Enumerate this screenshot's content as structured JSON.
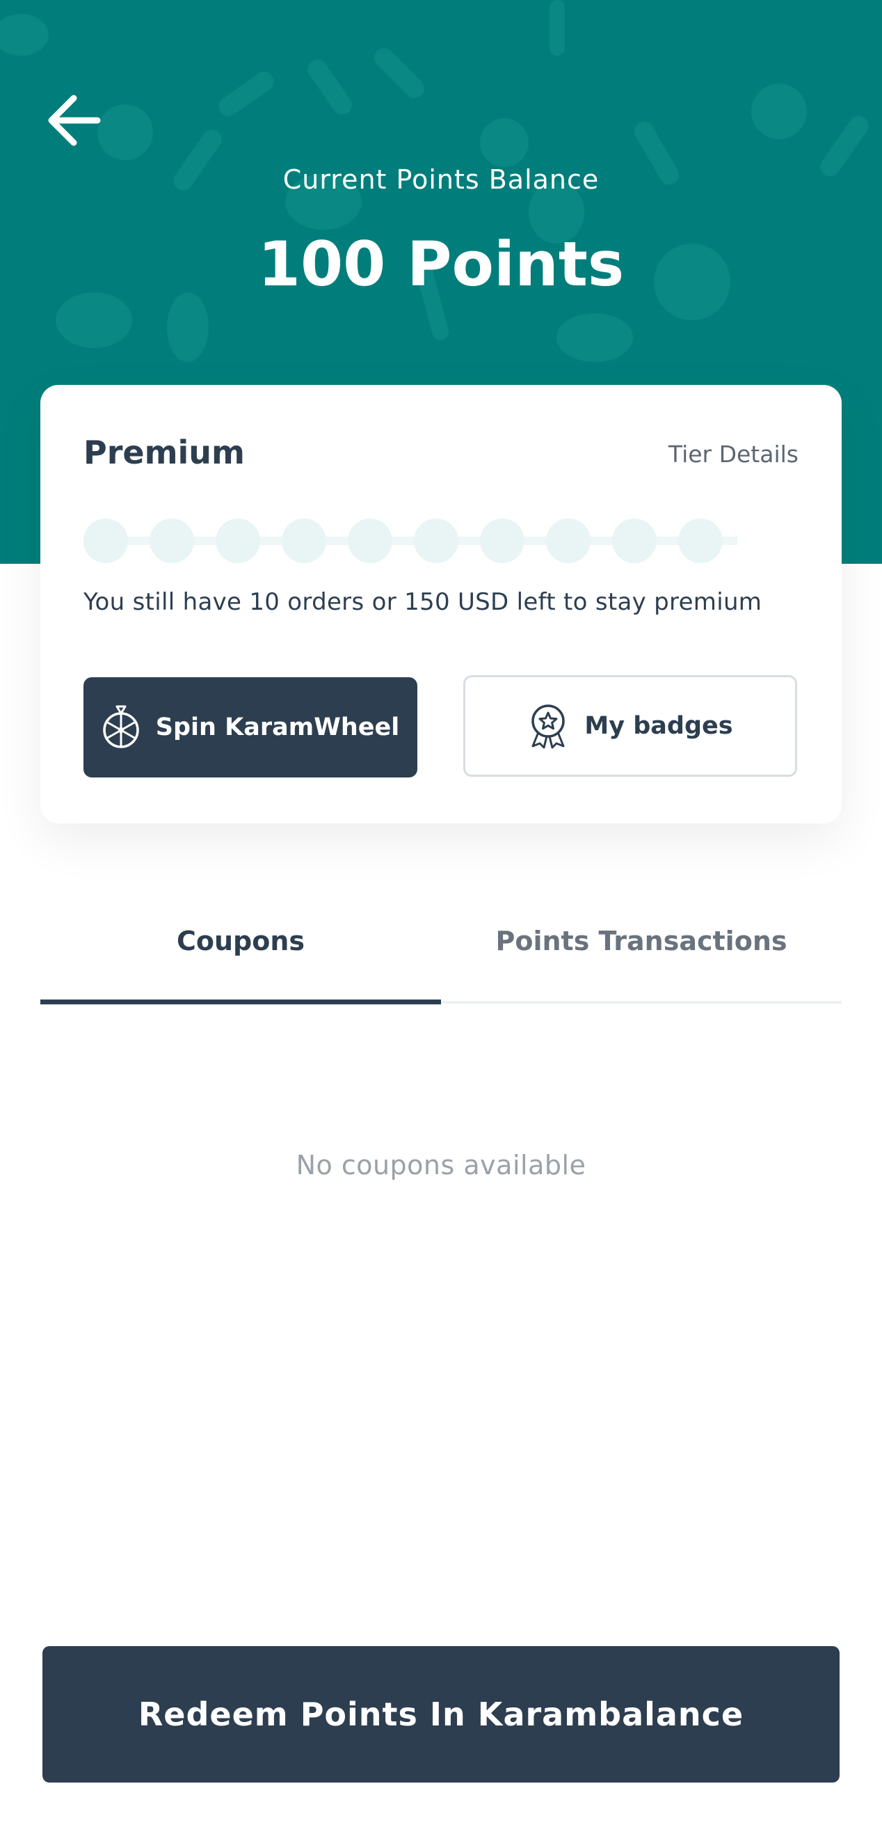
{
  "header": {
    "balance_label": "Current Points Balance",
    "balance_value": "100 Points",
    "background_color": "#017e7b"
  },
  "tier_card": {
    "tier_name": "Premium",
    "tier_details_link": "Tier Details",
    "progress_steps_total": 10,
    "progress_text": "You still have 10 orders or 150 USD left to stay premium",
    "spin_button": "Spin KaramWheel",
    "badges_button": "My badges"
  },
  "tabs": [
    {
      "label": "Coupons",
      "active": true
    },
    {
      "label": "Points Transactions",
      "active": false
    }
  ],
  "coupons": {
    "empty_message": "No coupons available"
  },
  "footer": {
    "redeem_button": "Redeem Points In Karambalance",
    "button_color": "#2d3e50"
  },
  "icons": {
    "back": "arrow-left-icon",
    "spin": "wheel-icon",
    "badges": "award-ribbon-icon"
  }
}
